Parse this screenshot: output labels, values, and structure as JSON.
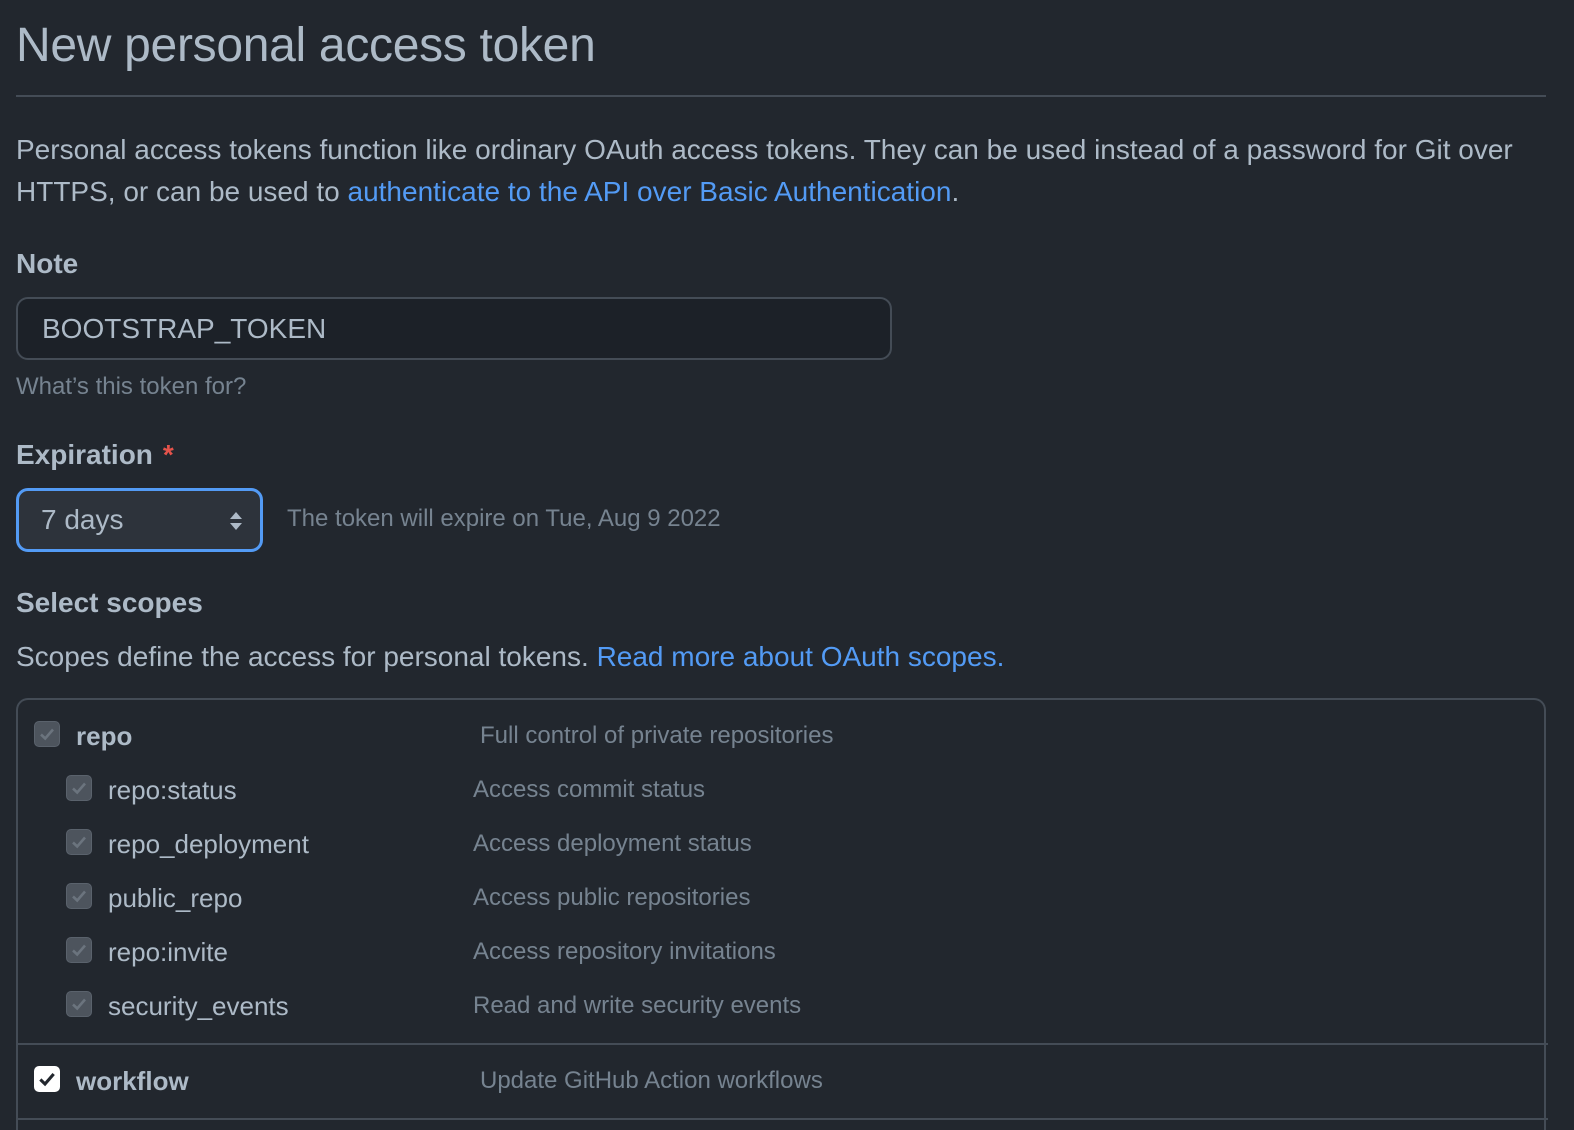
{
  "page": {
    "title": "New personal access token",
    "intro_text": "Personal access tokens function like ordinary OAuth access tokens. They can be used instead of a password for Git over HTTPS, or can be used to ",
    "intro_link": "authenticate to the API over Basic Authentication",
    "intro_end": "."
  },
  "note": {
    "label": "Note",
    "value": "BOOTSTRAP_TOKEN",
    "hint": "What’s this token for?"
  },
  "expiration": {
    "label": "Expiration",
    "required_mark": "*",
    "selected": "7 days",
    "expire_text": "The token will expire on Tue, Aug 9 2022"
  },
  "scopes": {
    "heading": "Select scopes",
    "description": "Scopes define the access for personal tokens. ",
    "description_link": "Read more about OAuth scopes.",
    "items": [
      {
        "name": "repo",
        "description": "Full control of private repositories",
        "checked": true,
        "level": 0
      },
      {
        "name": "repo:status",
        "description": "Access commit status",
        "checked": true,
        "level": 1
      },
      {
        "name": "repo_deployment",
        "description": "Access deployment status",
        "checked": true,
        "level": 1
      },
      {
        "name": "public_repo",
        "description": "Access public repositories",
        "checked": true,
        "level": 1
      },
      {
        "name": "repo:invite",
        "description": "Access repository invitations",
        "checked": true,
        "level": 1
      },
      {
        "name": "security_events",
        "description": "Read and write security events",
        "checked": true,
        "level": 1
      },
      {
        "name": "workflow",
        "description": "Update GitHub Action workflows",
        "checked": true,
        "level": 0
      }
    ]
  },
  "colors": {
    "background": "#22272e",
    "text": "#adbac7",
    "muted": "#768390",
    "link": "#539bf5",
    "focus_border": "#539bf5",
    "required": "#e5534b"
  },
  "icons": {
    "checkmark": "check-icon",
    "select_arrows": "select-arrows-icon"
  }
}
